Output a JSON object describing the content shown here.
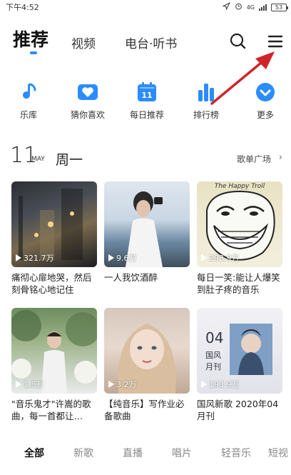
{
  "status_bar": {
    "time": "下午4:52",
    "network": "4G",
    "battery": "53"
  },
  "header": {
    "tabs": [
      {
        "label": "推荐"
      },
      {
        "label": "视频"
      },
      {
        "label": "电台·听书"
      }
    ]
  },
  "quick_nav": [
    {
      "label": "乐库",
      "icon": "music-note-icon"
    },
    {
      "label": "猜你喜欢",
      "icon": "heart-icon"
    },
    {
      "label": "每日推荐",
      "icon": "calendar-icon",
      "badge": "11"
    },
    {
      "label": "排行榜",
      "icon": "bar-chart-icon"
    },
    {
      "label": "更多",
      "icon": "chevron-down-icon"
    }
  ],
  "date": {
    "day": "11",
    "month": "MAY",
    "weekday": "周一",
    "link": "歌单广场",
    "chevron": "›"
  },
  "cards": [
    {
      "title": "痛彻心扉地哭，然后刻骨铭心地记住",
      "plays": "321.7万"
    },
    {
      "title": "一人我饮酒醉",
      "plays": "9.6万"
    },
    {
      "title": "每日一笑:能让人爆笑到肚子疼的音乐",
      "plays": "293.9万",
      "overlay": "The Happy Troll"
    },
    {
      "title": "\"音乐鬼才\"许嵩的歌曲，每一首都让…",
      "plays": "1.8万"
    },
    {
      "title": "【纯音乐】写作业必备歌曲",
      "plays": "3.2万"
    },
    {
      "title": "国风新歌 2020年04月刊",
      "plays": "193.9万",
      "overlay_num": "04",
      "overlay_line1": "国风",
      "overlay_line2": "月刊"
    }
  ],
  "categories": [
    {
      "label": "全部",
      "active": true
    },
    {
      "label": "新歌"
    },
    {
      "label": "直播"
    },
    {
      "label": "唱片"
    },
    {
      "label": "轻音乐"
    },
    {
      "label": "短视"
    }
  ],
  "colors": {
    "accent": "#2b8cff",
    "arrow": "#d0242b"
  }
}
